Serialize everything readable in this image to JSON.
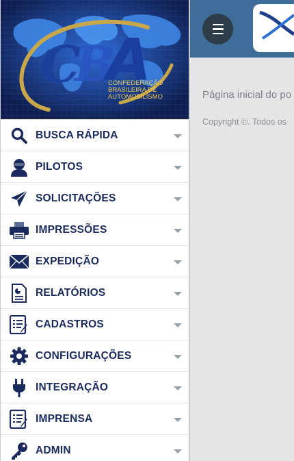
{
  "page": {
    "intro_text": "Página inicial do po",
    "copyright": "Copyright ©. Todos os"
  },
  "banner": {
    "org_line1": "CONFEDERAÇÃO",
    "org_line2": "BRASILEIRA  DE",
    "org_line3": "AUTOMOBILISMO"
  },
  "menu": [
    {
      "label": "BUSCA RÁPIDA",
      "icon": "search-icon"
    },
    {
      "label": "PILOTOS",
      "icon": "driver-icon"
    },
    {
      "label": "SOLICITAÇÕES",
      "icon": "paper-plane-icon"
    },
    {
      "label": "IMPRESSÕES",
      "icon": "printer-icon"
    },
    {
      "label": "EXPEDIÇÃO",
      "icon": "envelope-icon"
    },
    {
      "label": "RELATÓRIOS",
      "icon": "report-icon"
    },
    {
      "label": "CADASTROS",
      "icon": "form-icon"
    },
    {
      "label": "CONFIGURAÇÕES",
      "icon": "gear-icon"
    },
    {
      "label": "INTEGRAÇÃO",
      "icon": "plug-icon"
    },
    {
      "label": "IMPRENSA",
      "icon": "form-icon"
    },
    {
      "label": "ADMIN",
      "icon": "key-icon"
    }
  ],
  "colors": {
    "topbar": "#3f6d9a",
    "menu_text": "#1a2a5c",
    "banner_bg": "#16265a"
  }
}
